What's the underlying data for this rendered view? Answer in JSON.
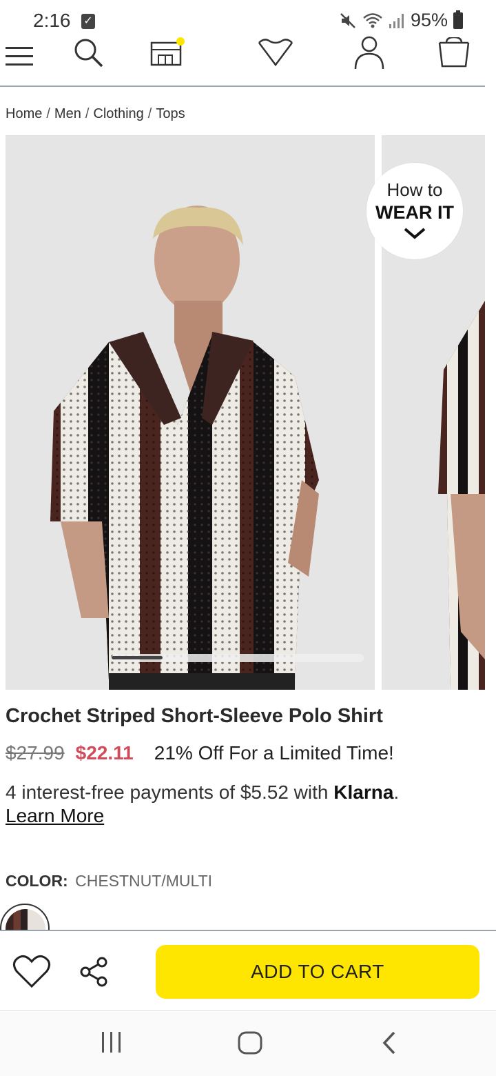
{
  "status_bar": {
    "time": "2:16",
    "battery": "95%"
  },
  "breadcrumb": [
    "Home",
    "Men",
    "Clothing",
    "Tops"
  ],
  "how_to_wear": {
    "top": "How to",
    "bottom": "WEAR IT"
  },
  "gallery": {
    "slide_index": 1,
    "slide_count": 5
  },
  "product": {
    "title": "Crochet Striped Short-Sleeve Polo Shirt",
    "price_original": "$27.99",
    "price_sale": "$22.11",
    "promo": "21% Off For a Limited Time!",
    "klarna_text": "4 interest-free payments of $5.52 with ",
    "klarna_brand": "Klarna",
    "klarna_period": ".",
    "learn_more": "Learn More",
    "color_label": "COLOR:",
    "color_value": "CHESTNUT/MULTI"
  },
  "actions": {
    "add_to_cart": "ADD TO CART"
  },
  "colors": {
    "accent_yellow": "#ffe600",
    "sale_red": "#d14b5a"
  }
}
